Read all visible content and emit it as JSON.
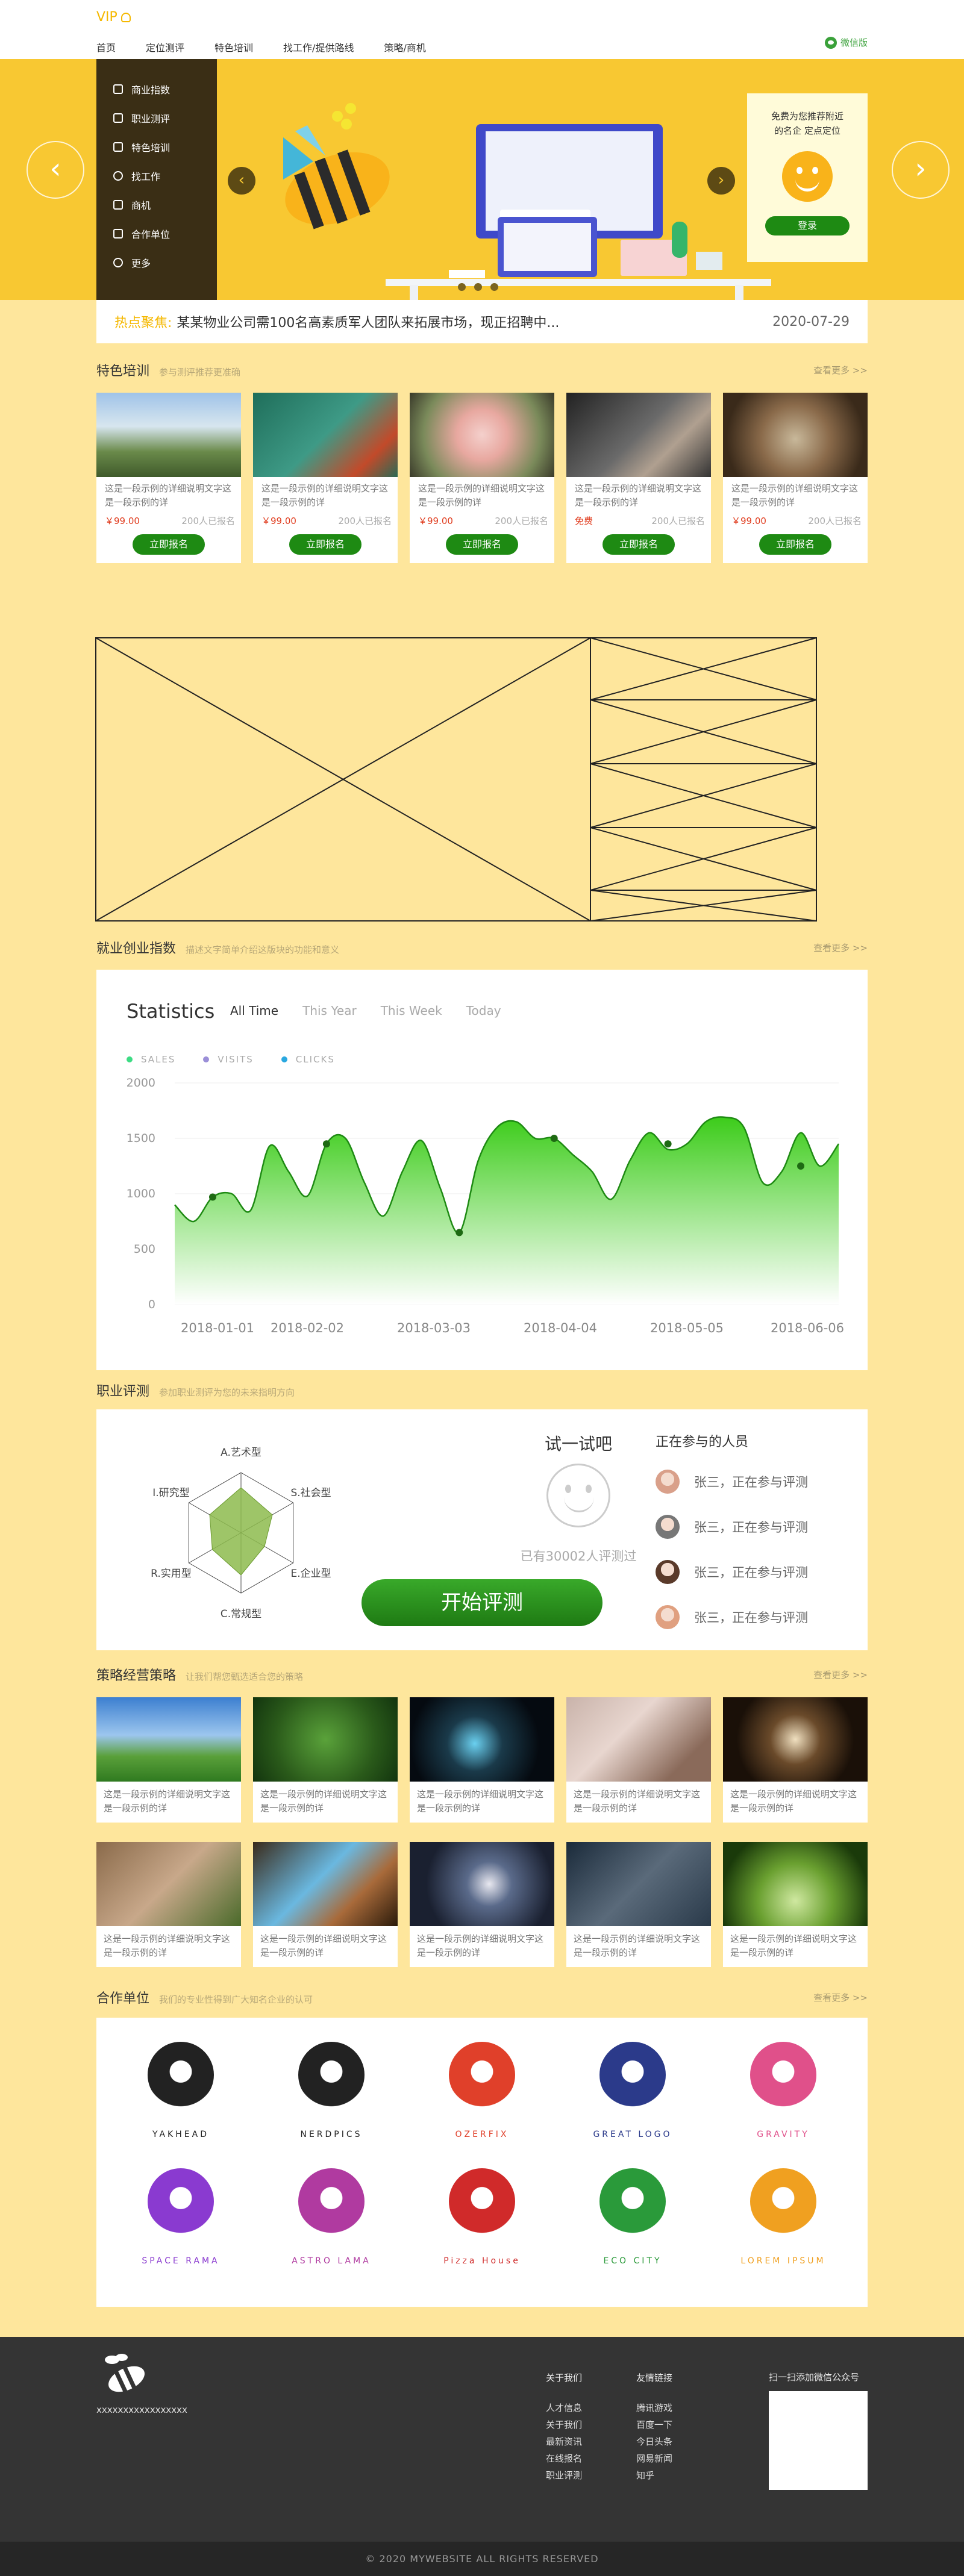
{
  "header": {
    "vip": "VIP",
    "nav": [
      "首页",
      "定位测评",
      "特色培训",
      "找工作/提供路线",
      "策略/商机"
    ],
    "wechat": "微信版"
  },
  "banner": {
    "menu": [
      {
        "icon": "briefcase-icon",
        "label": "商业指数"
      },
      {
        "icon": "clipboard-icon",
        "label": "职业测评"
      },
      {
        "icon": "graduation-cap-icon",
        "label": "特色培训"
      },
      {
        "icon": "person-icon",
        "label": "找工作"
      },
      {
        "icon": "bag-icon",
        "label": "商机"
      },
      {
        "icon": "building-icon",
        "label": "合作单位"
      },
      {
        "icon": "dots-icon",
        "label": "更多"
      }
    ],
    "login_text_1": "免费为您推荐附近",
    "login_text_2": "的名企 定点定位",
    "login_button": "登录"
  },
  "news": {
    "label": "热点聚焦:",
    "text": "某某物业公司需100名高素质军人团队来拓展市场，现正招聘中...",
    "date": "2020-07-29"
  },
  "colors": {
    "accent": "#f8c832",
    "green": "#1e8a13",
    "price": "#e03c1e",
    "panel_bg": "#fee69c"
  },
  "training": {
    "title": "特色培训",
    "subtitle": "参与测评推荐更准确",
    "more": "查看更多 >>",
    "cards": [
      {
        "desc": "这是一段示例的详细说明文字这是一段示例的详",
        "price": "￥99.00",
        "count": "200人已报名",
        "button": "立即报名"
      },
      {
        "desc": "这是一段示例的详细说明文字这是一段示例的详",
        "price": "￥99.00",
        "count": "200人已报名",
        "button": "立即报名"
      },
      {
        "desc": "这是一段示例的详细说明文字这是一段示例的详",
        "price": "￥99.00",
        "count": "200人已报名",
        "button": "立即报名"
      },
      {
        "desc": "这是一段示例的详细说明文字这是一段示例的详",
        "price": "免费",
        "count": "200人已报名",
        "button": "立即报名"
      },
      {
        "desc": "这是一段示例的详细说明文字这是一段示例的详",
        "price": "￥99.00",
        "count": "200人已报名",
        "button": "立即报名"
      }
    ]
  },
  "employment": {
    "title": "就业创业指数",
    "subtitle": "描述文字简单介绍这版块的功能和意义",
    "more": "查看更多 >>"
  },
  "chart_data": {
    "type": "area",
    "title": "Statistics",
    "filters": [
      "All Time",
      "This Year",
      "This Week",
      "Today"
    ],
    "active_filter": "All Time",
    "legend": [
      "SALES",
      "VISITS",
      "CLICKS"
    ],
    "legend_colors": [
      "#3ddc84",
      "#9b8fd8",
      "#2aa8e0"
    ],
    "x_ticks": [
      "2018-01-01",
      "2018-02-02",
      "2018-03-03",
      "2018-04-04",
      "2018-05-05",
      "2018-06-06"
    ],
    "y_ticks": [
      "0",
      "500",
      "1000",
      "1500",
      "2000"
    ],
    "ylim": [
      0,
      2000
    ],
    "series": [
      {
        "values": [
          900,
          750,
          970,
          1000,
          850,
          1430,
          1200,
          980,
          1450,
          1500,
          1100,
          800,
          1200,
          1480,
          1050,
          650,
          1300,
          1600,
          1650,
          1500,
          1500,
          1350,
          1200,
          950,
          1300,
          1550,
          1400,
          1450,
          1650,
          1690,
          1600,
          1100,
          1200,
          1550,
          1250,
          1450
        ]
      }
    ],
    "markers": [
      {
        "i": 2,
        "v": 970
      },
      {
        "i": 8,
        "v": 1450
      },
      {
        "i": 15,
        "v": 650
      },
      {
        "i": 20,
        "v": 1500
      },
      {
        "i": 26,
        "v": 1450
      },
      {
        "i": 33,
        "v": 1250
      }
    ],
    "line_color": "#1e8a13",
    "fill_top": "#3ccc1a",
    "fill_bottom": "#ffffff"
  },
  "career": {
    "title": "职业评测",
    "subtitle": "参加职业测评为您的未来指明方向",
    "radar_labels": [
      "A.艺术型",
      "S.社会型",
      "E.企业型",
      "C.常规型",
      "R.实用型",
      "I.研究型"
    ],
    "radar_values": [
      0.75,
      0.6,
      0.45,
      0.7,
      0.55,
      0.6
    ],
    "try_title": "试一试吧",
    "tested": "已有30002人评测过",
    "start": "开始评测",
    "participants_title": "正在参与的人员",
    "participants": [
      "张三，正在参与评测",
      "张三，正在参与评测",
      "张三，正在参与评测",
      "张三，正在参与评测"
    ]
  },
  "strategy": {
    "title": "策略经营策略",
    "subtitle": "让我们帮您甄选适合您的策略",
    "more": "查看更多 >>",
    "desc": "这是一段示例的详细说明文字这是一段示例的详"
  },
  "partners": {
    "title": "合作单位",
    "subtitle": "我们的专业性得到广大知名企业的认可",
    "more": "查看更多 >>",
    "logos": [
      "YAKHEAD",
      "NERDPICS",
      "OZERFIX",
      "GREAT LOGO",
      "GRAVITY",
      "SPACE RAMA",
      "ASTRO LAMA",
      "Pizza House",
      "ECO CITY",
      "LOREM IPSUM"
    ]
  },
  "footer": {
    "tagline": "xxxxxxxxxxxxxxxxx",
    "col1_title": "关于我们",
    "col1": [
      "人才信息",
      "关于我们",
      "最新资讯",
      "在线报名",
      "职业评测"
    ],
    "col2_title": "友情链接",
    "col2": [
      "腾讯游戏",
      "百度一下",
      "今日头条",
      "网易新闻",
      "知乎"
    ],
    "qr_title": "扫一扫添加微信公众号",
    "copyright": "© 2020 MYWEBSITE ALL RIGHTS RESERVED"
  }
}
